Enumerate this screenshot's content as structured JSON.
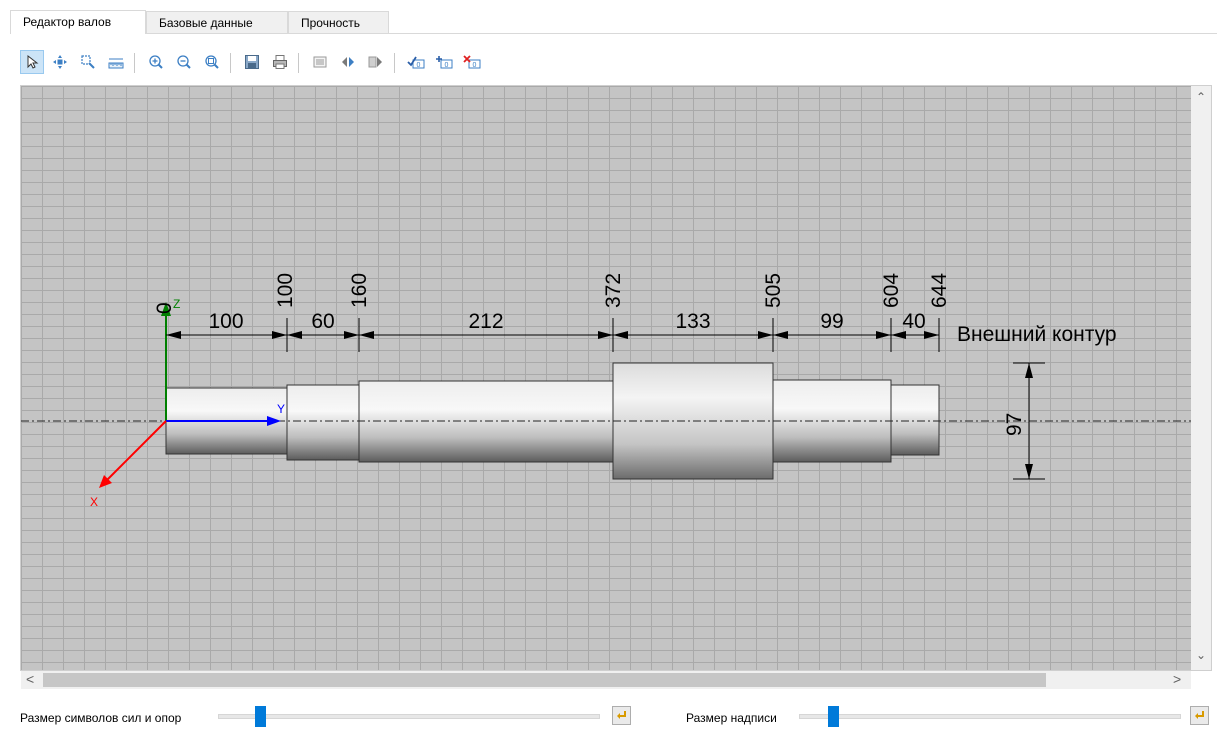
{
  "tabs": [
    {
      "label": "Редактор валов",
      "active": true
    },
    {
      "label": "Базовые данные",
      "active": false
    },
    {
      "label": "Прочность",
      "active": false
    }
  ],
  "toolbar": {
    "buttons": [
      {
        "icon": "pointer-icon",
        "active": true
      },
      {
        "icon": "pan-icon"
      },
      {
        "icon": "zoom-window-icon"
      },
      {
        "icon": "ruler-icon"
      },
      {
        "icon": "zoom-in-icon"
      },
      {
        "icon": "zoom-out-icon"
      },
      {
        "icon": "zoom-extents-icon"
      },
      {
        "icon": "save-icon"
      },
      {
        "icon": "print-icon"
      },
      {
        "icon": "list-icon"
      },
      {
        "icon": "mirror-icon"
      },
      {
        "icon": "mirror-copy-icon"
      },
      {
        "icon": "check-value-icon"
      },
      {
        "icon": "add-value-icon"
      },
      {
        "icon": "delete-value-icon"
      }
    ]
  },
  "drawing": {
    "axes": {
      "z": "Z",
      "y": "Y",
      "x": "X",
      "origin_label": "0"
    },
    "position_labels": [
      "100",
      "160",
      "372",
      "505",
      "604",
      "644"
    ],
    "segment_lengths": [
      "100",
      "60",
      "212",
      "133",
      "99",
      "40"
    ],
    "contour_label": "Внешний контур",
    "diameter_label": "97",
    "colors": {
      "z_axis": "#008000",
      "y_axis": "#0000ff",
      "x_axis": "#ff0000"
    }
  },
  "bottom": {
    "force_symbol_size_label": "Размер символов сил и опор",
    "caption_size_label": "Размер надписи",
    "force_symbol_size_value": 0.11,
    "caption_size_value": 0.09
  }
}
